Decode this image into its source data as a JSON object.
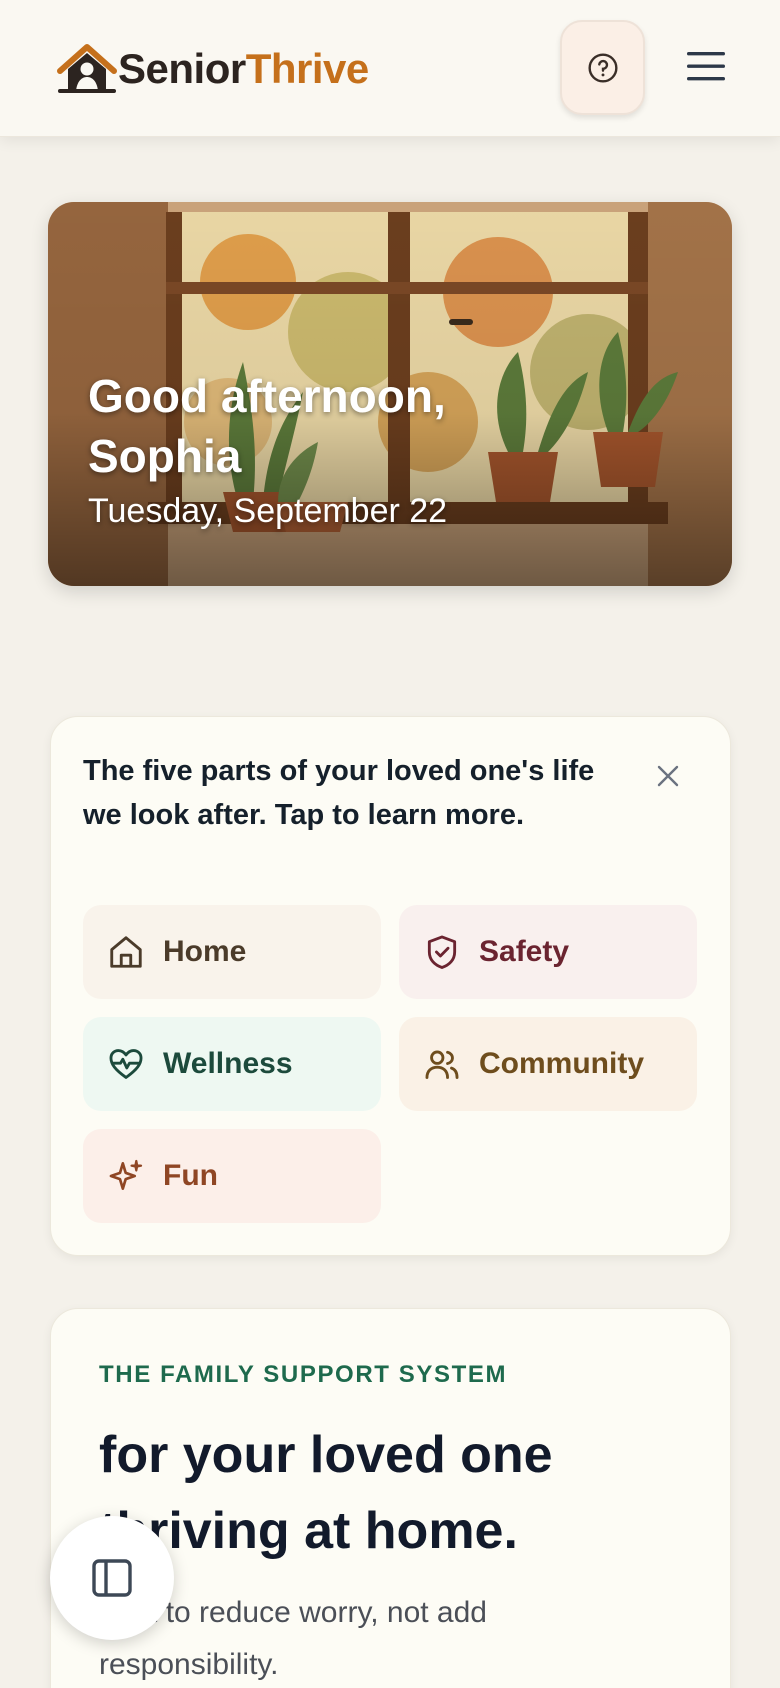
{
  "header": {
    "logo_part1": "Senior",
    "logo_part2": "Thrive",
    "brand_color": "#c5701b"
  },
  "hero": {
    "greeting": "Good afternoon, Sophia",
    "date": "Tuesday, September 22"
  },
  "areas": {
    "intro": "The five parts of your loved one's life we look after. Tap to learn more.",
    "items": [
      {
        "label": "Home",
        "icon": "home-icon",
        "color": "#4b3b2a"
      },
      {
        "label": "Safety",
        "icon": "shield-check-icon",
        "color": "#6b2430"
      },
      {
        "label": "Wellness",
        "icon": "heart-pulse-icon",
        "color": "#1c4a3c"
      },
      {
        "label": "Community",
        "icon": "users-icon",
        "color": "#6e4d1d"
      },
      {
        "label": "Fun",
        "icon": "sparkles-icon",
        "color": "#8f4624"
      }
    ]
  },
  "support": {
    "eyebrow": "THE FAMILY SUPPORT SYSTEM",
    "title": "for your loved one thriving at home.",
    "text": "Built to reduce worry, not add responsibility."
  },
  "icons": {
    "help": "help-circle-icon",
    "menu": "hamburger-menu-icon",
    "close": "close-icon",
    "sidebar": "sidebar-toggle-icon"
  }
}
